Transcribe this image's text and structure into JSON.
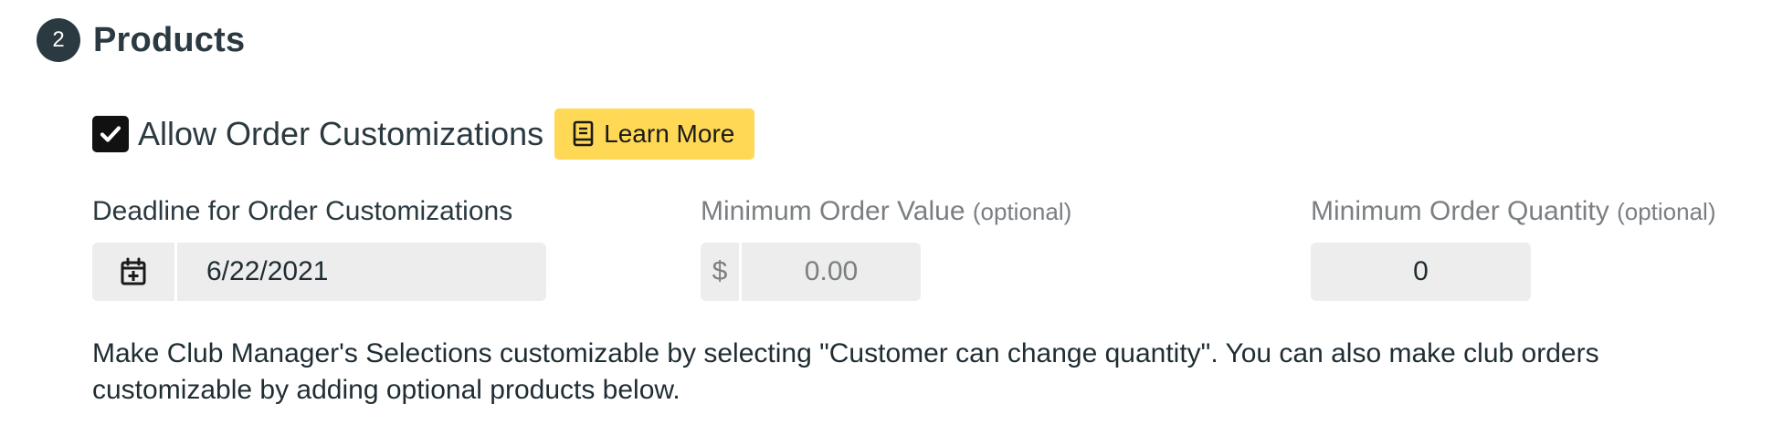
{
  "section": {
    "step_number": "2",
    "title": "Products"
  },
  "customizations": {
    "checked": true,
    "label": "Allow Order Customizations",
    "learn_more_label": "Learn More"
  },
  "deadline": {
    "label": "Deadline for Order Customizations",
    "value": "6/22/2021",
    "icon": "calendar-plus-icon"
  },
  "min_value": {
    "label": "Minimum Order Value",
    "optional_label": "(optional)",
    "currency_symbol": "$",
    "placeholder": "0.00"
  },
  "min_quantity": {
    "label": "Minimum Order Quantity",
    "optional_label": "(optional)",
    "value": "0"
  },
  "info_text": "Make Club Manager's Selections customizable by selecting \"Customer can change quantity\". You can also make club orders customizable by adding optional products below.",
  "colors": {
    "badge": "#2b3940",
    "learn_more_bg": "#ffd955",
    "input_bg": "#ededed",
    "muted_text": "#7a7f82"
  }
}
